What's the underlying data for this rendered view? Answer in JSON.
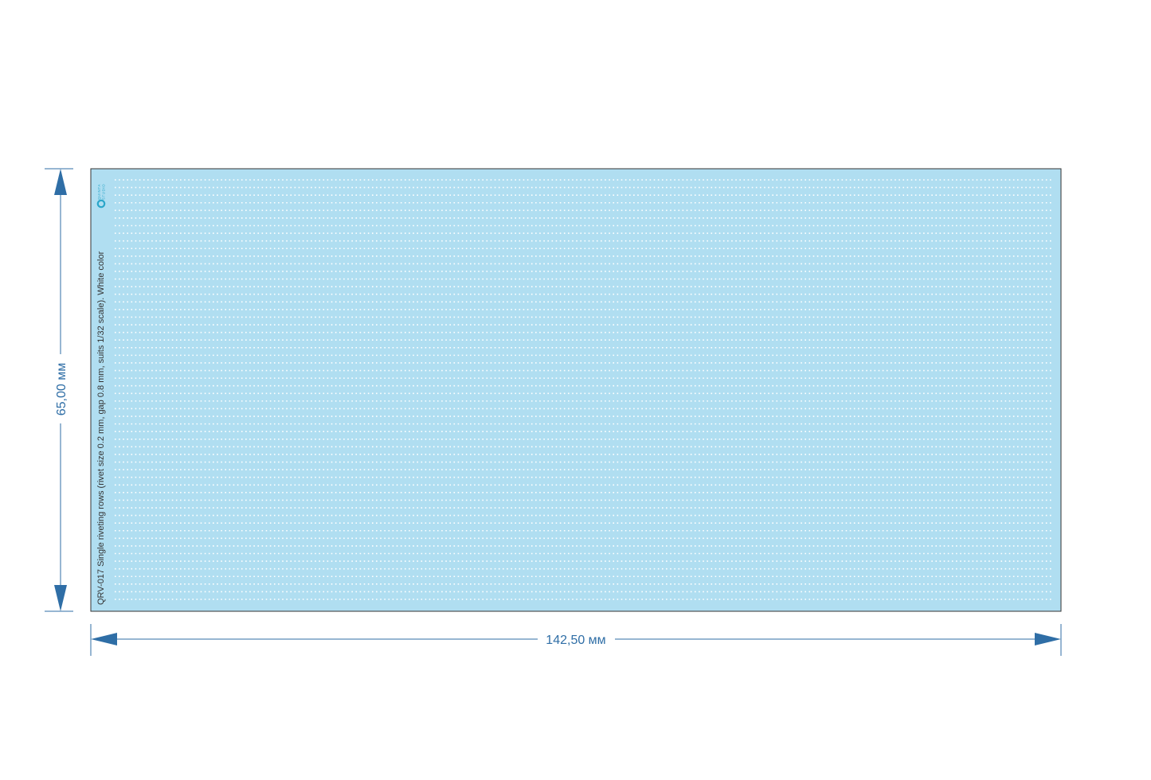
{
  "sheet": {
    "caption": "QRV-017 Single riveting rows (rivet size 0.2 mm, gap 0.8 mm, suits 1/32 scale). White color",
    "logo": {
      "icon": "quinta-studio-q-logo",
      "text_top": "QUINTA",
      "text_bottom": "STUDIO"
    },
    "rivet_rows": 56,
    "rivets_per_row": 230,
    "sheet_color": "#b0def1",
    "rivet_color": "#ffffff",
    "border_color": "#333333"
  },
  "dimensions": {
    "width_label": "142,50 мм",
    "height_label": "65,00 мм",
    "color": "#2f6ea6"
  }
}
